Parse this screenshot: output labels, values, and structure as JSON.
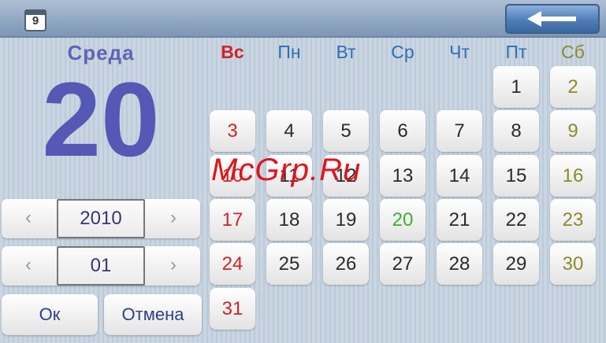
{
  "topbar": {
    "calendar_icon_text": "9",
    "back_icon": "arrow-left-icon"
  },
  "date_display": {
    "weekday": "Среда",
    "day": "20"
  },
  "year_spinner": {
    "value": "2010",
    "prev": "‹",
    "next": "›"
  },
  "month_spinner": {
    "value": "01",
    "prev": "‹",
    "next": "›"
  },
  "buttons": {
    "ok": "Ок",
    "cancel": "Отмена"
  },
  "colors": {
    "sunday": "#d0232a",
    "weekday": "#2b2b2b",
    "saturday": "#8c8a2e",
    "selected": "#3fae33",
    "header_weekday": "#2f6fb3"
  },
  "calendar": {
    "headers": [
      "Вс",
      "Пн",
      "Вт",
      "Ср",
      "Чт",
      "Пт",
      "Сб"
    ],
    "weeks": [
      [
        "",
        "",
        "",
        "",
        "",
        "1",
        "2"
      ],
      [
        "3",
        "4",
        "5",
        "6",
        "7",
        "8",
        "9"
      ],
      [
        "10",
        "11",
        "12",
        "13",
        "14",
        "15",
        "16"
      ],
      [
        "17",
        "18",
        "19",
        "20",
        "21",
        "22",
        "23"
      ],
      [
        "24",
        "25",
        "26",
        "27",
        "28",
        "29",
        "30"
      ],
      [
        "31",
        "",
        "",
        "",
        "",
        "",
        ""
      ]
    ],
    "selected_day": "20"
  },
  "watermark": "McGrp.Ru"
}
